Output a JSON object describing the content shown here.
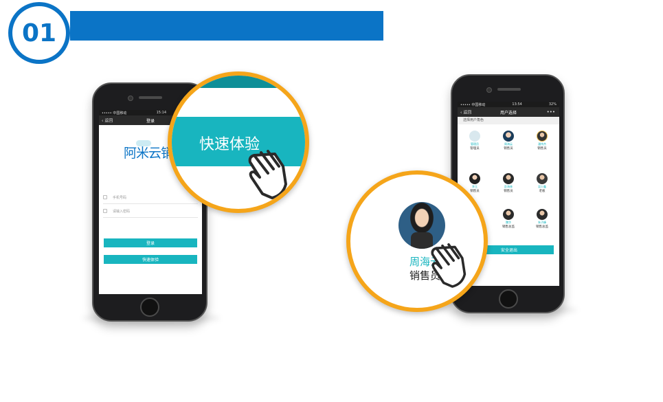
{
  "step": {
    "number": "01"
  },
  "login_phone": {
    "status_carrier": "••••• 中国移动 ",
    "status_time": "15:14",
    "nav_back": "返回",
    "nav_title": "登录",
    "logo_text": "阿米云销",
    "phone_placeholder": "手机号码",
    "password_placeholder": "请输入密码",
    "login_button": "登录",
    "quick_button": "快速体验"
  },
  "zoom_quick": {
    "label": "快速体验"
  },
  "role_phone": {
    "status_carrier": "••••• 中国移动 ",
    "status_time": "13:54",
    "status_battery": "32%",
    "nav_back": "返回",
    "nav_title": "用户选择",
    "nav_more": "•••",
    "section_title": "选择用户角色",
    "users": [
      {
        "name": "管理员",
        "role": "管理员"
      },
      {
        "name": "周海云",
        "role": "销售员"
      },
      {
        "name": "潘伟杰",
        "role": "销售员"
      },
      {
        "name": "李玉",
        "role": "销售员"
      },
      {
        "name": "彭海林",
        "role": "销售员"
      },
      {
        "name": "吴少鑫",
        "role": "老板"
      },
      {
        "name": "魏华",
        "role": "销售总监"
      },
      {
        "name": "朱子峰",
        "role": "销售总监"
      }
    ],
    "logout_button": "安全退出"
  },
  "zoom_user": {
    "name": "周海云",
    "role": "销售员"
  },
  "colors": {
    "brand_blue": "#0b74c6",
    "teal": "#18b5bf",
    "ring_orange": "#f5a51a"
  }
}
